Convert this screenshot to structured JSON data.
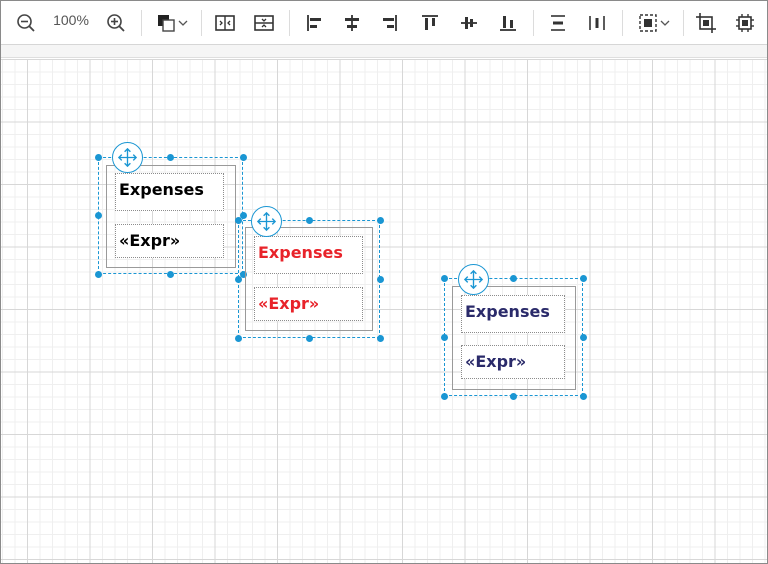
{
  "toolbar": {
    "zoom_level": "100%",
    "icons": [
      "zoom-out-icon",
      "zoom-in-icon",
      "fill-color-icon",
      "chevron-down-icon",
      "split-horizontal-icon",
      "split-vertical-icon",
      "align-left-icon",
      "align-center-icon",
      "align-right-icon",
      "align-top-icon",
      "align-middle-icon",
      "align-bottom-icon",
      "distribute-vertical-icon",
      "distribute-horizontal-icon",
      "select-icon",
      "crop-icon",
      "fit-icon"
    ]
  },
  "colors": {
    "selection": "#1a96d3",
    "node1_text": "#000000",
    "node2_text": "#e8232a",
    "node3_text": "#2a2a6a"
  },
  "nodes": [
    {
      "header": "Expenses",
      "body": "«Expr»"
    },
    {
      "header": "Expenses",
      "body": "«Expr»"
    },
    {
      "header": "Expenses",
      "body": "«Expr»"
    }
  ]
}
